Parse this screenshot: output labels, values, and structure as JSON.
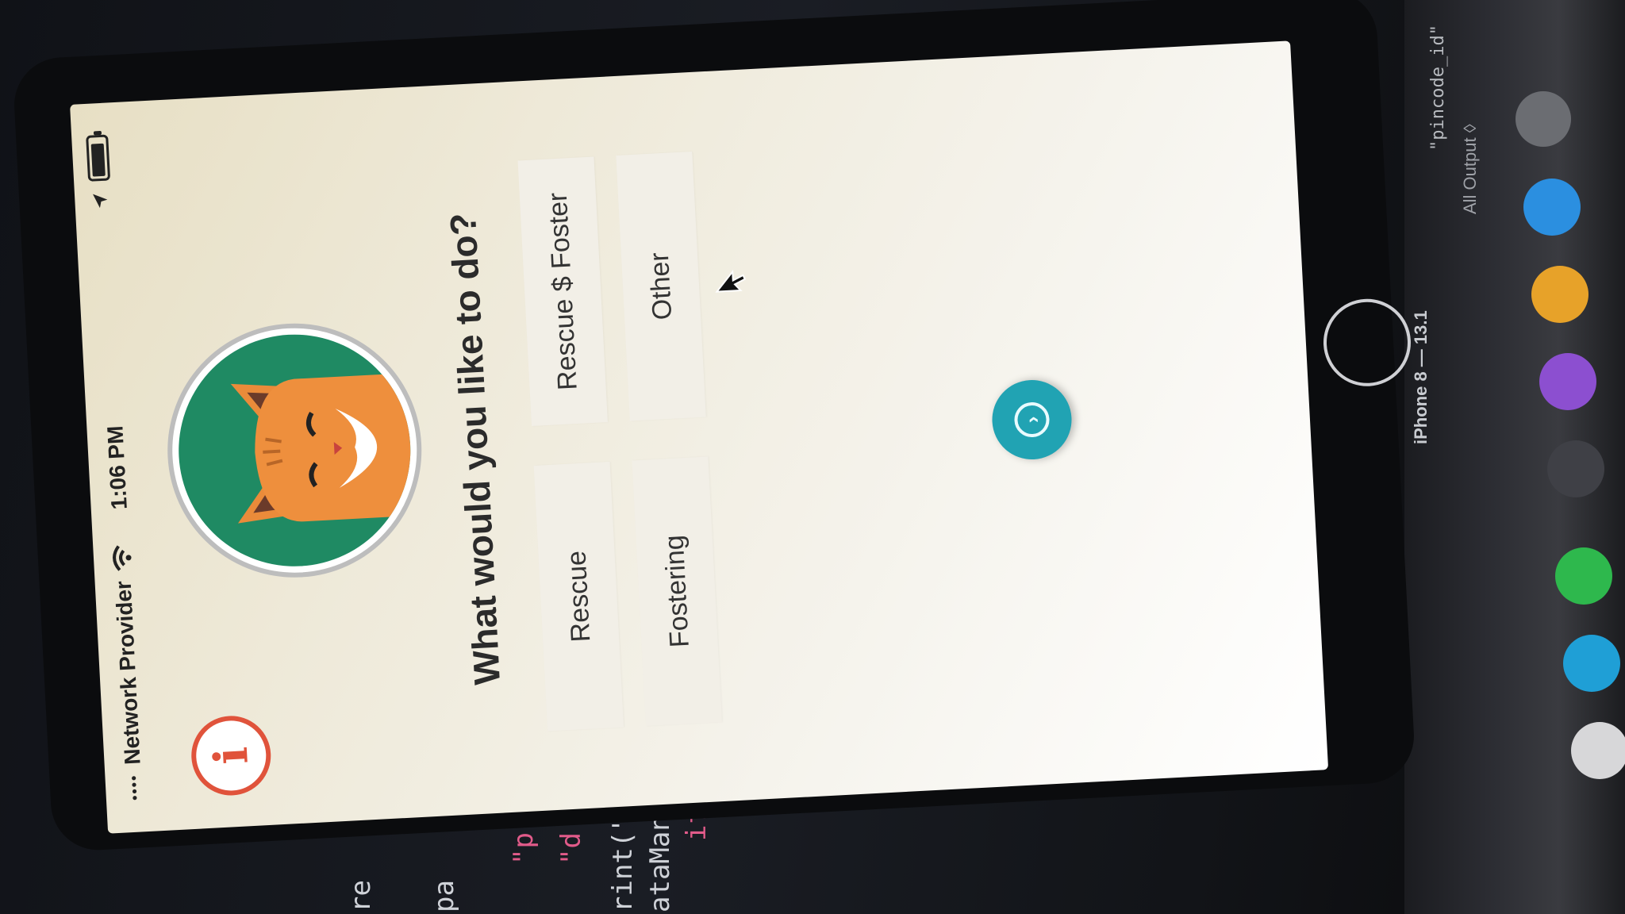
{
  "status_bar": {
    "signal": "••••",
    "carrier": "Network Provider",
    "time": "1:06 PM",
    "battery_level": 0.9
  },
  "app": {
    "info_icon_glyph": "i",
    "question": "What would you like to do?",
    "options": [
      {
        "label": "Rescue"
      },
      {
        "label": "Rescue $ Foster"
      },
      {
        "label": "Fostering"
      },
      {
        "label": "Other"
      }
    ],
    "next_icon_glyph": "›"
  },
  "colors": {
    "info_accent": "#e0533b",
    "avatar_background": "#1f8a63",
    "fab": "#21a3b3"
  },
  "device": {
    "simulator_label": "iPhone 8 — 13.1",
    "output_label": "All Output ◊",
    "code_fragment": "\"pincode_id\""
  },
  "editor": {
    "lines": [
      "re",
      "pa",
      "\"p",
      "\"d",
      "rint(\"",
      "ataMan",
      "if"
    ]
  }
}
